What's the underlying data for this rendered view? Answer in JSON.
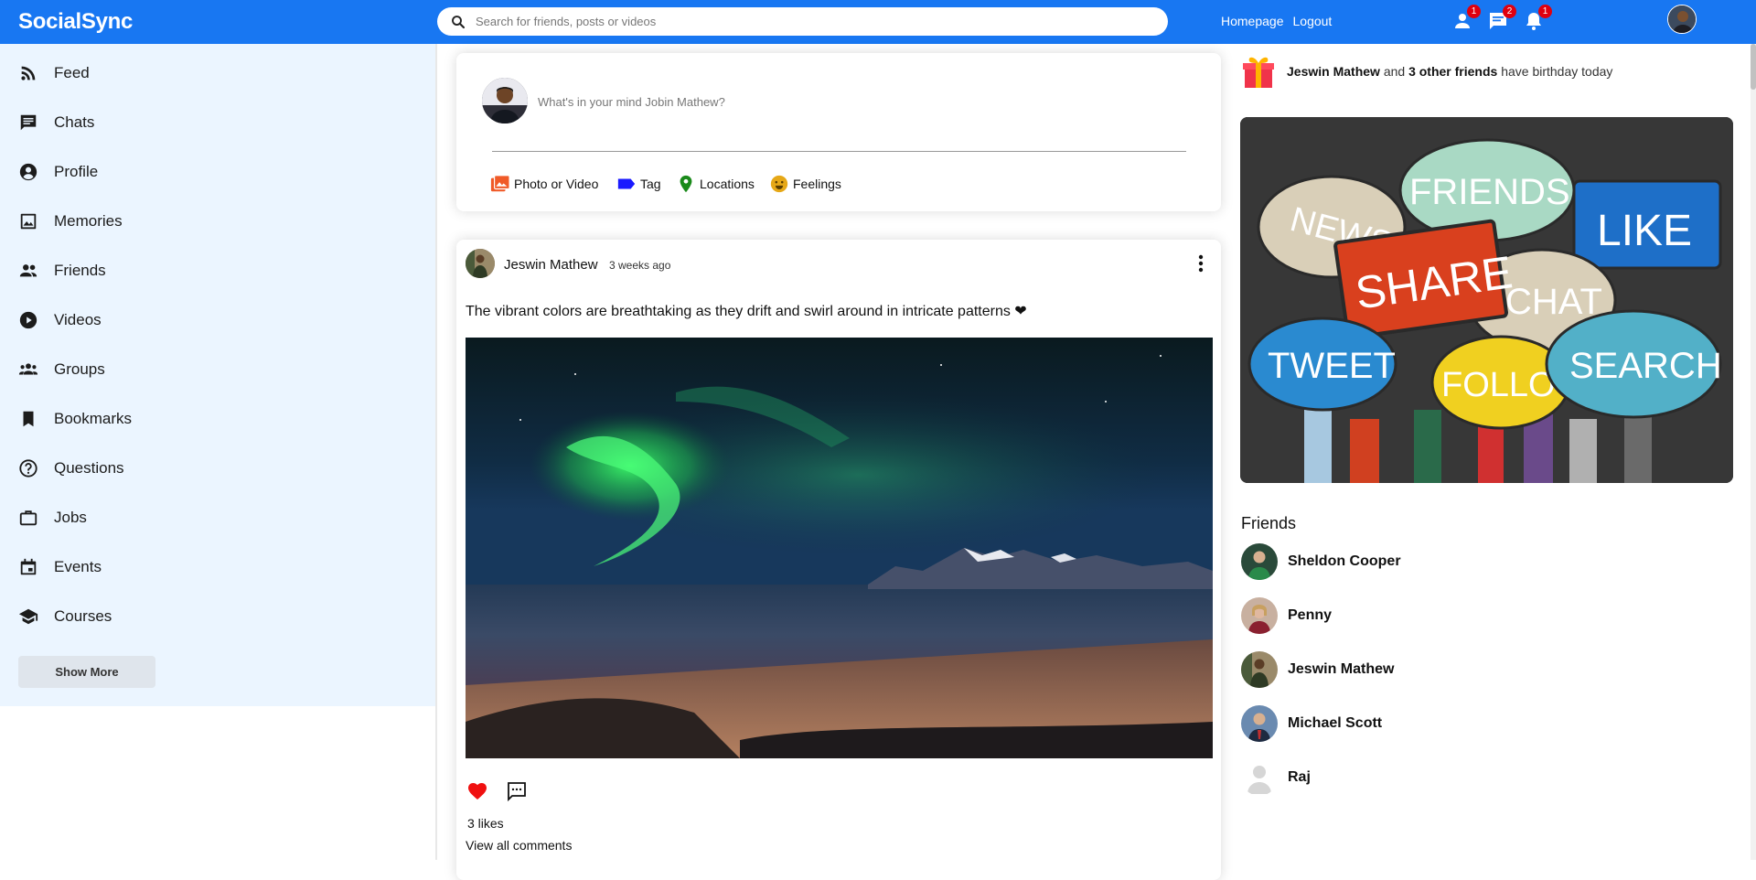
{
  "app": {
    "name": "SocialSync"
  },
  "search": {
    "placeholder": "Search for friends, posts or videos"
  },
  "topbar": {
    "links": [
      "Homepage",
      "Logout"
    ],
    "badges": {
      "friend_requests": "1",
      "messages": "2",
      "notifications": "1"
    }
  },
  "sidebar": {
    "items": [
      {
        "label": "Feed",
        "icon": "rss-icon"
      },
      {
        "label": "Chats",
        "icon": "chat-icon"
      },
      {
        "label": "Profile",
        "icon": "account-circle-icon"
      },
      {
        "label": "Memories",
        "icon": "image-icon"
      },
      {
        "label": "Friends",
        "icon": "people-icon"
      },
      {
        "label": "Videos",
        "icon": "play-circle-icon"
      },
      {
        "label": "Groups",
        "icon": "group-icon"
      },
      {
        "label": "Bookmarks",
        "icon": "bookmark-icon"
      },
      {
        "label": "Questions",
        "icon": "help-circle-icon"
      },
      {
        "label": "Jobs",
        "icon": "briefcase-icon"
      },
      {
        "label": "Events",
        "icon": "calendar-icon"
      },
      {
        "label": "Courses",
        "icon": "school-icon"
      }
    ],
    "show_more": "Show More"
  },
  "share": {
    "placeholder": "What's in your mind Jobin Mathew?",
    "options": [
      {
        "label": "Photo or Video",
        "color": "#f05a28"
      },
      {
        "label": "Tag",
        "color": "#1a1aff"
      },
      {
        "label": "Locations",
        "color": "#1a8a1a"
      },
      {
        "label": "Feelings",
        "color": "#e6a817"
      }
    ]
  },
  "post": {
    "author": "Jeswin Mathew",
    "time": "3 weeks ago",
    "text": "The vibrant colors are breathtaking as they drift and swirl around in intricate patterns ❤",
    "likes": "3 likes",
    "view_comments": "View all comments"
  },
  "birthday": {
    "name": "Jeswin Mathew",
    "and": "and",
    "others": "3 other friends",
    "suffix": "have birthday today"
  },
  "ad": {
    "bubbles": [
      "NEWS",
      "FRIENDS",
      "LIKE",
      "SHARE",
      "CHAT",
      "TWEET",
      "FOLLOW",
      "SEARCH"
    ]
  },
  "friends": {
    "title": "Friends",
    "list": [
      "Sheldon Cooper",
      "Penny",
      "Jeswin Mathew",
      "Michael Scott",
      "Raj"
    ]
  },
  "colors": {
    "brand": "#1877f2",
    "sidebar_bg": "#ebf5ff",
    "badge": "#e0000f"
  }
}
